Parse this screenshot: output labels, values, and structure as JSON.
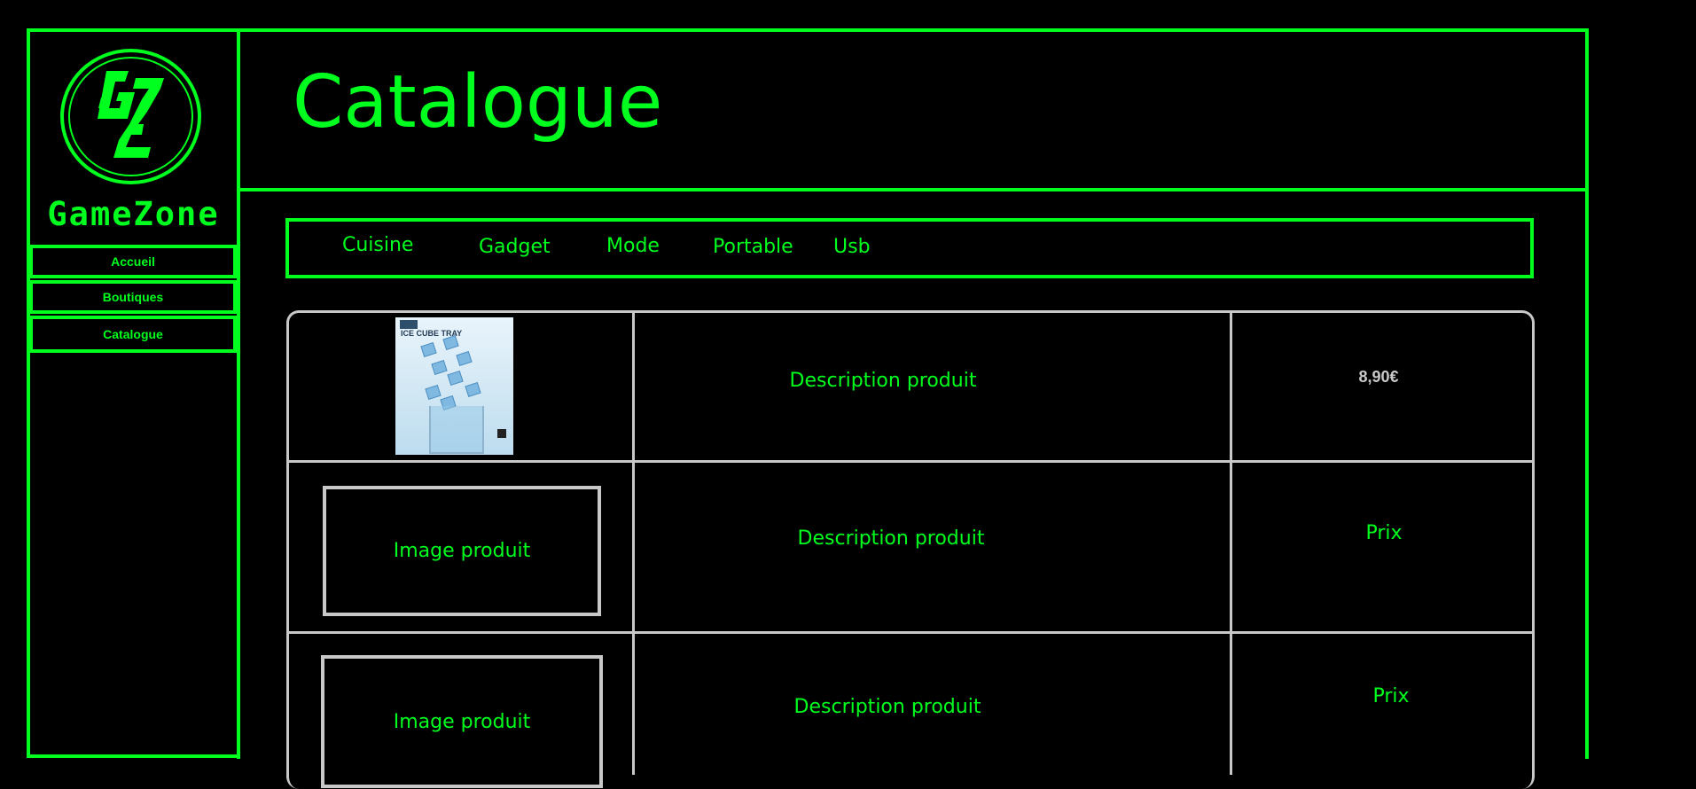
{
  "brand": {
    "name": "GameZone",
    "logo_icon": "gamezone-gz-logo",
    "accent_color": "#00ff1e"
  },
  "sidebar": {
    "items": [
      {
        "label": "Accueil"
      },
      {
        "label": "Boutiques"
      },
      {
        "label": "Catalogue"
      }
    ]
  },
  "header": {
    "title": "Catalogue"
  },
  "categories": [
    "Cuisine",
    "Gadget",
    "Mode",
    "Portable",
    "Usb"
  ],
  "products": [
    {
      "image": "ice-cube-tray-image",
      "image_text": "ICE CUBE TRAY",
      "description": "Description produit",
      "price": "8,90€"
    },
    {
      "image_placeholder": "Image produit",
      "description": "Description produit",
      "price": "Prix"
    },
    {
      "image_placeholder": "Image produit",
      "description": "Description produit",
      "price": "Prix"
    }
  ],
  "colors": {
    "background": "#000000",
    "accent": "#00ff1e",
    "table_lines": "#c8c8c8"
  }
}
